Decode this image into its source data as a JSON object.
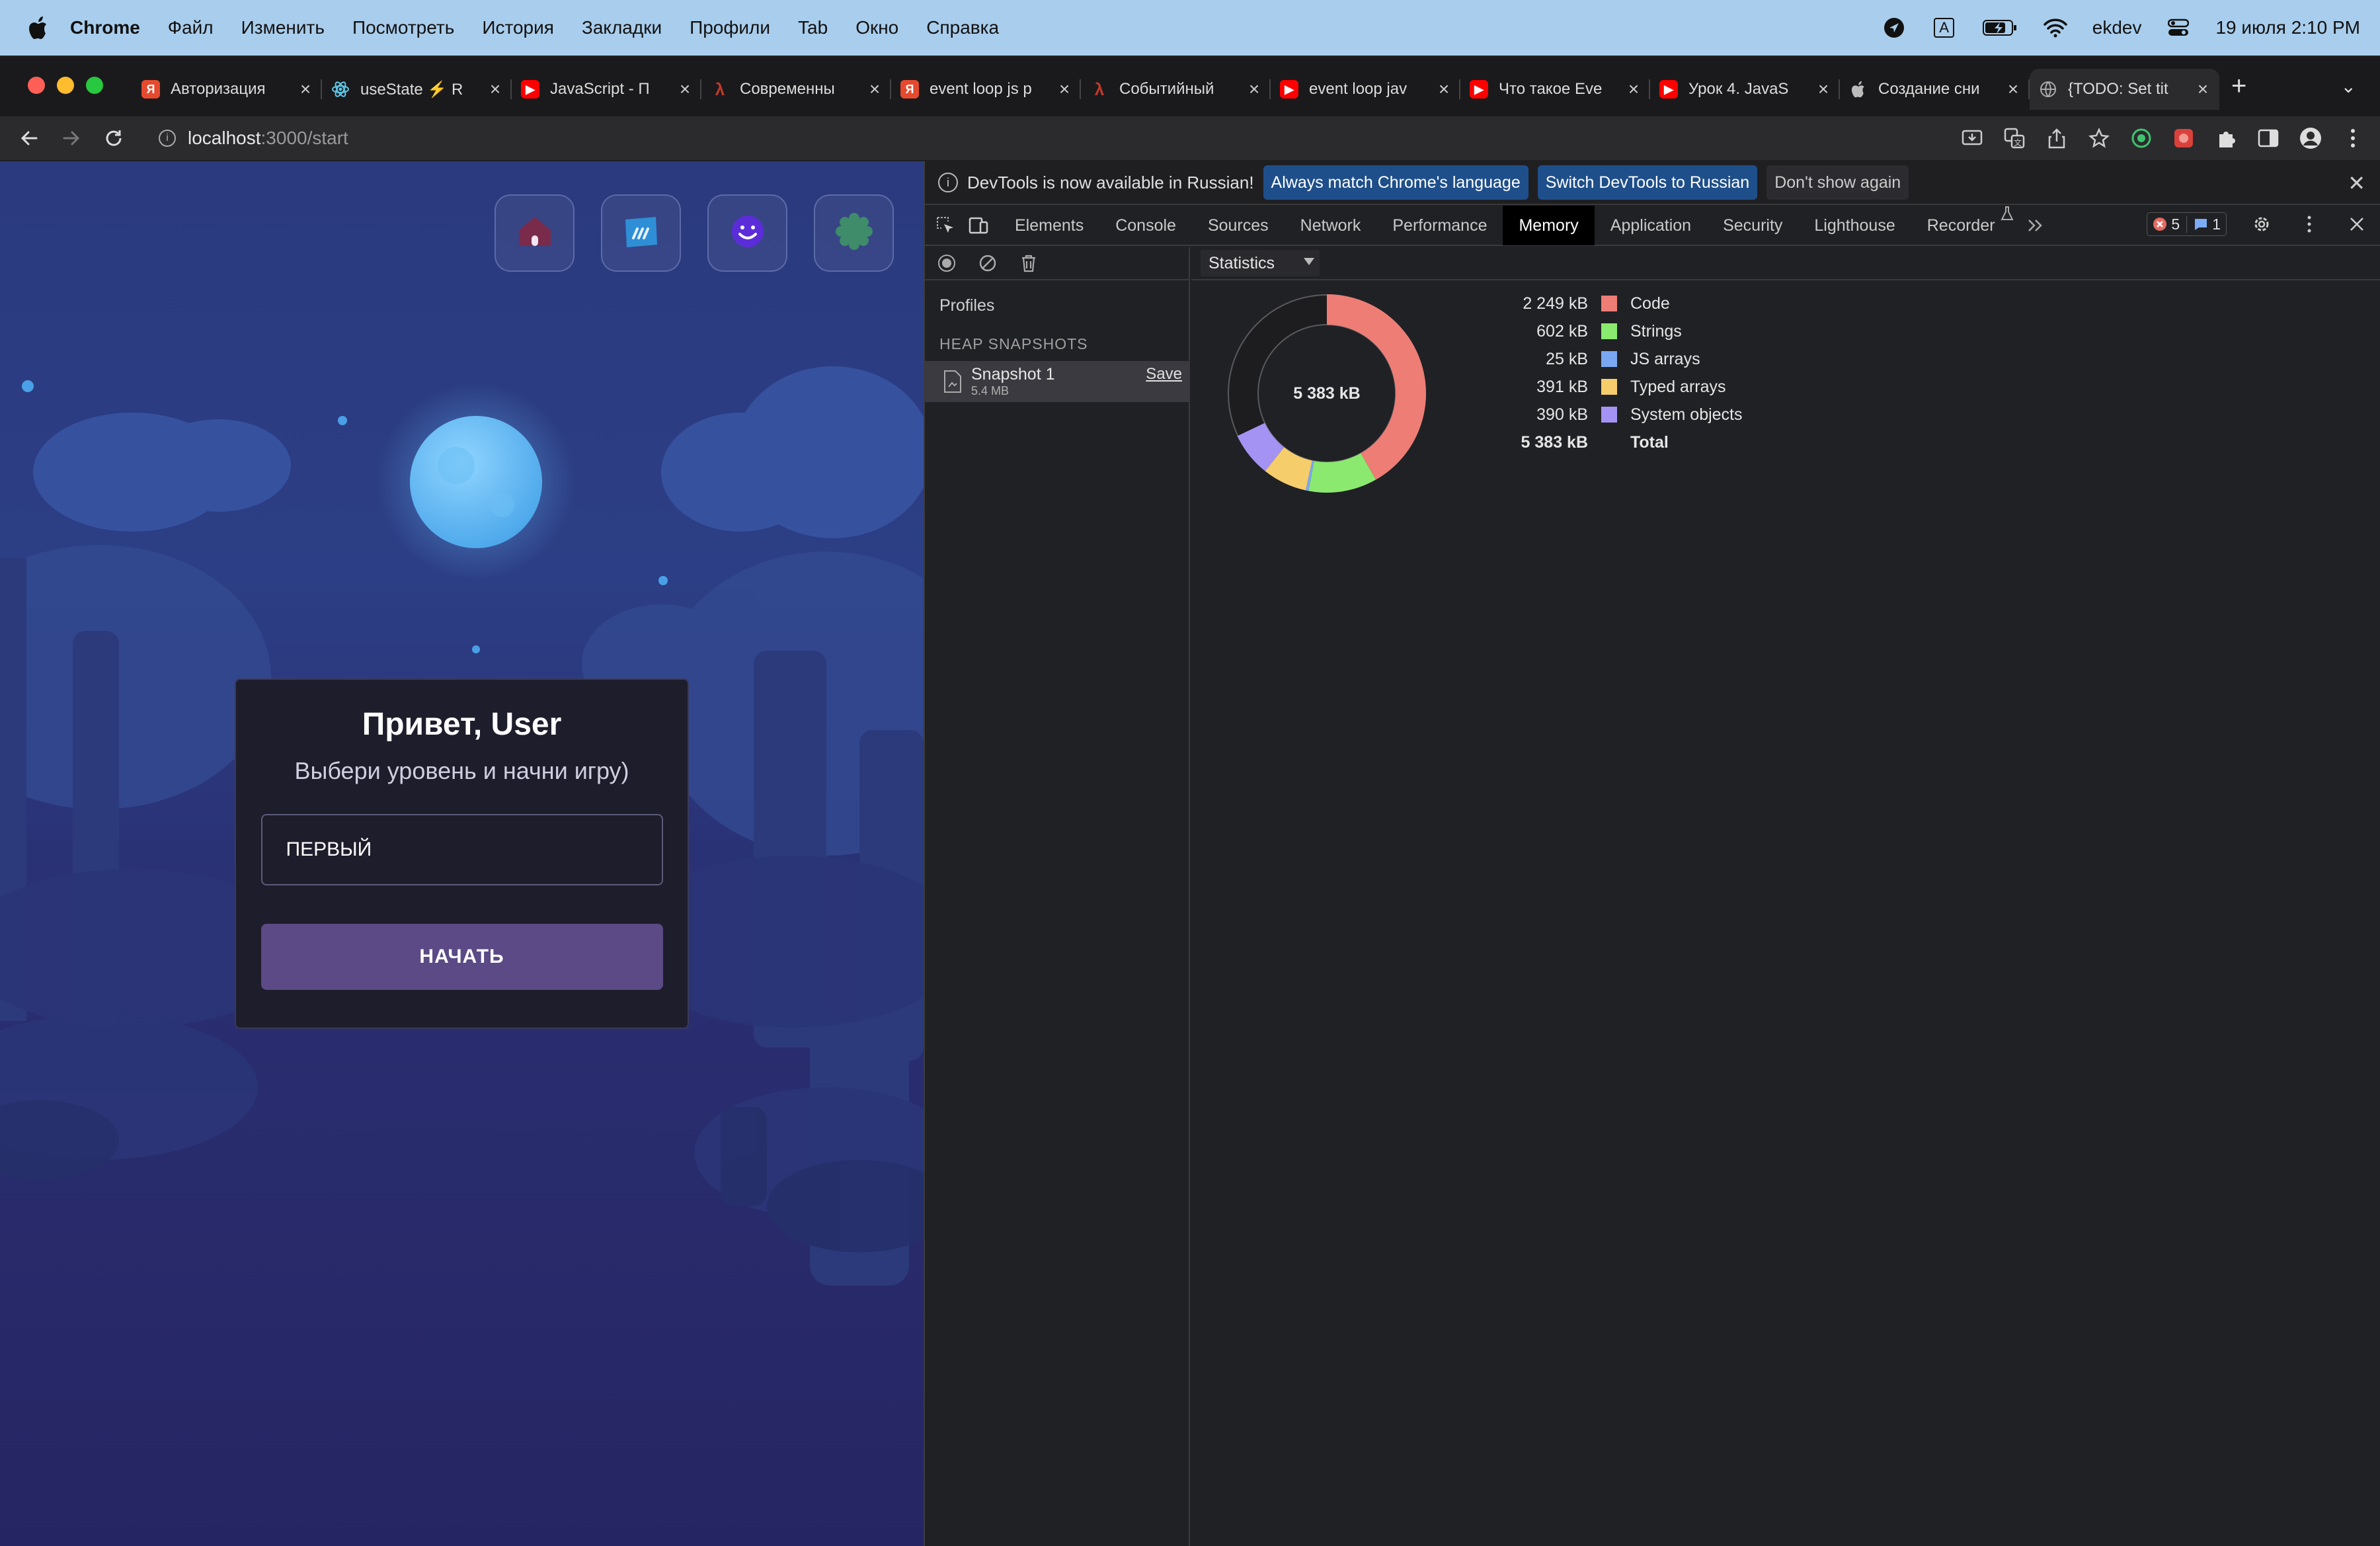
{
  "menubar": {
    "app": "Chrome",
    "items": [
      "Файл",
      "Изменить",
      "Посмотреть",
      "История",
      "Закладки",
      "Профили",
      "Tab",
      "Окно",
      "Справка"
    ],
    "keyboard": "A",
    "user": "ekdev",
    "datetime": "19 июля  2:10 PM"
  },
  "tabs": [
    {
      "title": "Авторизация",
      "favicon": "yandex-icon",
      "color": "#e64a2e",
      "glyph": "Я"
    },
    {
      "title": "useState ⚡ R",
      "favicon": "react-icon",
      "color": "#5ec8e8",
      "glyph": ""
    },
    {
      "title": "JavaScript - П",
      "favicon": "youtube-icon",
      "color": "#ff0000",
      "glyph": "▶"
    },
    {
      "title": "Современны",
      "favicon": "learnjs-icon",
      "color": "#c0392b",
      "glyph": "λ"
    },
    {
      "title": "event loop js p",
      "favicon": "yandex-icon",
      "color": "#e64a2e",
      "glyph": "Я"
    },
    {
      "title": "Событийный",
      "favicon": "learnjs-icon",
      "color": "#c0392b",
      "glyph": "λ"
    },
    {
      "title": "event loop jav",
      "favicon": "youtube-icon",
      "color": "#ff0000",
      "glyph": "▶"
    },
    {
      "title": "Что такое Eve",
      "favicon": "youtube-icon",
      "color": "#ff0000",
      "glyph": "▶"
    },
    {
      "title": "Урок 4. JavaS",
      "favicon": "youtube-icon",
      "color": "#ff0000",
      "glyph": "▶"
    },
    {
      "title": "Создание сни",
      "favicon": "apple-icon",
      "color": "#888888",
      "glyph": ""
    },
    {
      "title": "{TODO: Set tit",
      "favicon": "globe-icon",
      "color": "#777777",
      "glyph": "",
      "active": true
    }
  ],
  "address": {
    "host": "localhost",
    "path": ":3000/start"
  },
  "page": {
    "greeting": "Привет, User",
    "subtitle": "Выбери уровень и начни игру)",
    "level": "ПЕРВЫЙ",
    "start": "НАЧАТЬ",
    "top_buttons": [
      "home-icon",
      "cards-icon",
      "smile-icon",
      "gear-icon"
    ]
  },
  "devtools": {
    "infobar": {
      "message": "DevTools is now available in Russian!",
      "btn_match": "Always match Chrome's language",
      "btn_switch": "Switch DevTools to Russian",
      "btn_dismiss": "Don't show again"
    },
    "tabs": [
      "Elements",
      "Console",
      "Sources",
      "Network",
      "Performance",
      "Memory",
      "Application",
      "Security",
      "Lighthouse",
      "Recorder"
    ],
    "active_tab": "Memory",
    "errors": "5",
    "messages": "1",
    "sidebar": {
      "profiles": "Profiles",
      "heading": "HEAP SNAPSHOTS",
      "snapshot_name": "Snapshot 1",
      "snapshot_size": "5.4 MB",
      "save": "Save"
    },
    "view": "Statistics",
    "stats": {
      "total_center": "5 383 kB",
      "rows": [
        {
          "value": "2 249 kB",
          "name": "Code",
          "color": "#ee7d76"
        },
        {
          "value": "602 kB",
          "name": "Strings",
          "color": "#8ae96e"
        },
        {
          "value": "25 kB",
          "name": "JS arrays",
          "color": "#7aa7f2"
        },
        {
          "value": "391 kB",
          "name": "Typed arrays",
          "color": "#f6cd6b"
        },
        {
          "value": "390 kB",
          "name": "System objects",
          "color": "#a493f3"
        }
      ],
      "total_value": "5 383 kB",
      "total_label": "Total"
    }
  }
}
